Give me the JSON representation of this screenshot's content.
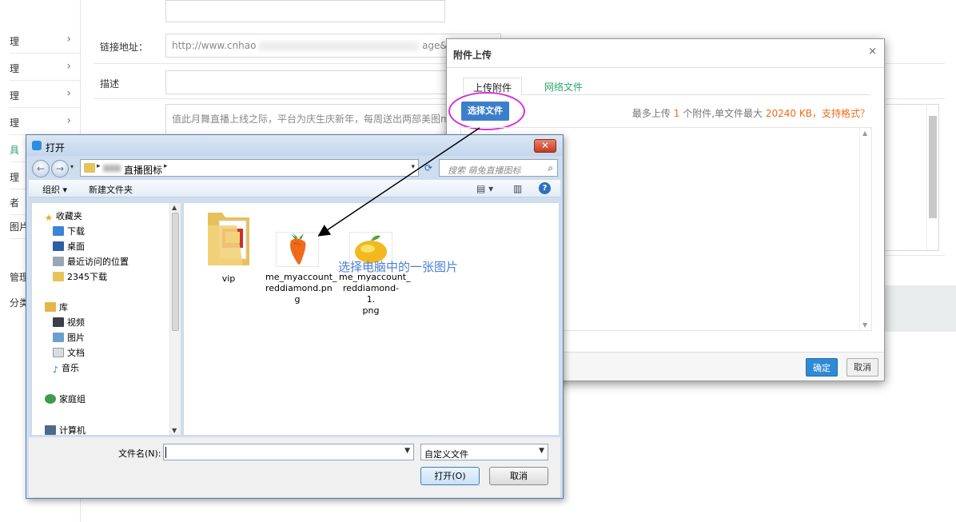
{
  "sidebar": {
    "items": [
      {
        "label": "理"
      },
      {
        "label": "理"
      },
      {
        "label": "理"
      },
      {
        "label": "理"
      },
      {
        "label": "具"
      },
      {
        "label": "理"
      },
      {
        "label": "者"
      },
      {
        "label": "图片"
      }
    ],
    "extra": [
      {
        "label": "管理"
      },
      {
        "label": "分类"
      }
    ]
  },
  "form": {
    "link_label": "链接地址：",
    "link_value_prefix": "http://www.cnhao",
    "link_value_suffix": "age&a=",
    "desc_label": "描述",
    "content_text": "值此月舞直播上线之际，平台为庆生庆新年，每周送出两部美图m"
  },
  "upload_dialog": {
    "title": "附件上传",
    "close_glyph": "×",
    "tabs": [
      {
        "label": "上传附件"
      },
      {
        "label": "网络文件"
      }
    ],
    "choose_button": "选择文件",
    "info_prefix": "最多上传",
    "info_count": "1",
    "info_mid": "个附件,单文件最大",
    "info_size": "20240 KB",
    "info_formats": "，支持格式？",
    "ok_button": "确定",
    "cancel_button": "取消",
    "highlight_color": "#d630d6"
  },
  "open_dialog": {
    "title": "打开",
    "close_glyph": "✕",
    "path_current": "直播图标",
    "search_placeholder": "搜索 萌兔直播图标",
    "toolbar": {
      "organize": "组织 ▾",
      "new_folder": "新建文件夹",
      "help": "?"
    },
    "nav": [
      {
        "label": "收藏夹",
        "icon": "star-icon"
      },
      {
        "label": "下载",
        "icon": "download-folder-icon"
      },
      {
        "label": "桌面",
        "icon": "desktop-icon"
      },
      {
        "label": "最近访问的位置",
        "icon": "recent-places-icon"
      },
      {
        "label": "2345下载",
        "icon": "folder-icon"
      },
      {
        "label": "库",
        "icon": "library-icon"
      },
      {
        "label": "视频",
        "icon": "video-icon"
      },
      {
        "label": "图片",
        "icon": "pictures-icon"
      },
      {
        "label": "文档",
        "icon": "documents-icon"
      },
      {
        "label": "音乐",
        "icon": "music-icon"
      },
      {
        "label": "家庭组",
        "icon": "homegroup-icon"
      },
      {
        "label": "计算机",
        "icon": "computer-icon"
      }
    ],
    "files": [
      {
        "name": "vip",
        "type": "folder"
      },
      {
        "name": "me_myaccount_reddiamond.png",
        "lines": [
          "me_myaccount_",
          "reddiamond.pn",
          "g"
        ],
        "type": "carrot"
      },
      {
        "name": "me_myaccount_reddiamond-1.png",
        "lines": [
          "me_myaccount_",
          "reddiamond-1.",
          "png"
        ],
        "type": "mango"
      }
    ],
    "annotation": "选择电脑中的一张图片",
    "filename_label": "文件名(N):",
    "filename_value": "",
    "filetype_value": "自定义文件",
    "open_button": "打开(O)",
    "cancel_button": "取消"
  }
}
